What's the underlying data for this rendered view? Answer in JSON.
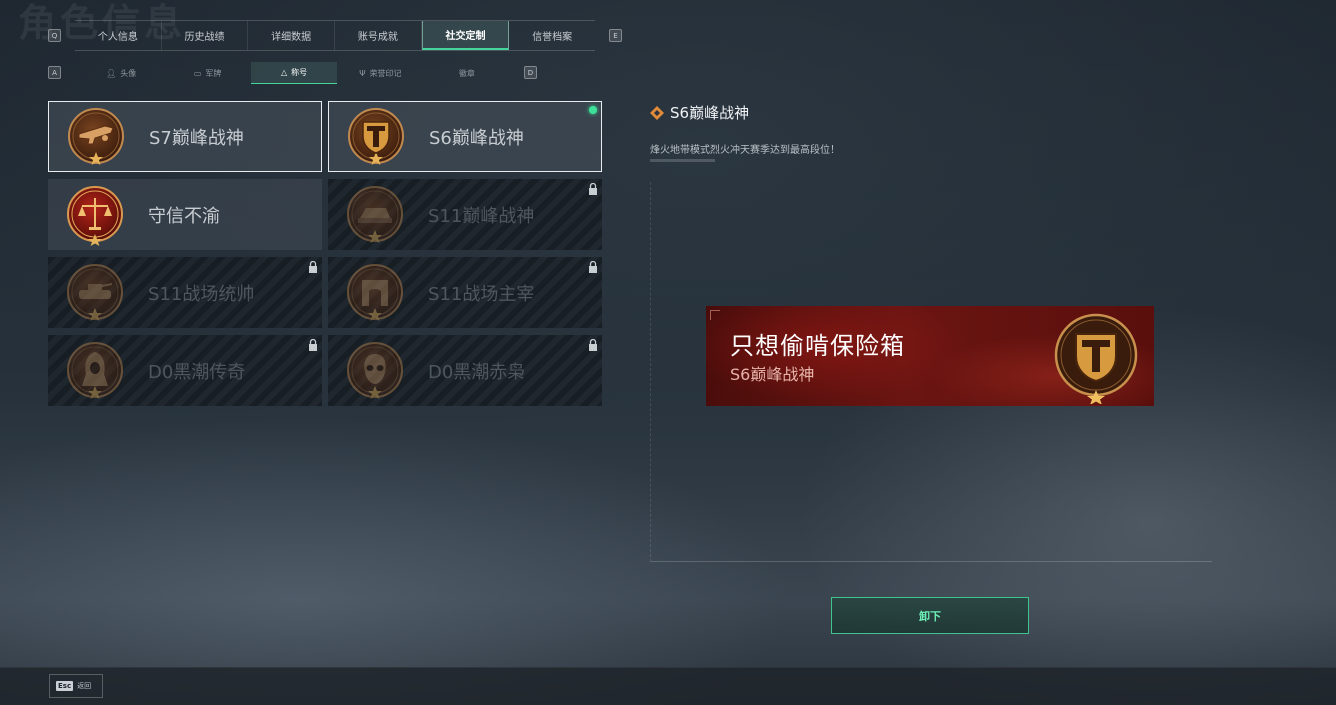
{
  "page": {
    "background_title": "角色信息"
  },
  "top_tabs": {
    "left_key": "Q",
    "right_key": "E",
    "items": [
      {
        "label": "个人信息",
        "active": false
      },
      {
        "label": "历史战绩",
        "active": false
      },
      {
        "label": "详细数据",
        "active": false
      },
      {
        "label": "账号成就",
        "active": false
      },
      {
        "label": "社交定制",
        "active": true
      },
      {
        "label": "信誉档案",
        "active": false
      }
    ]
  },
  "sub_tabs": {
    "left_key": "A",
    "right_key": "D",
    "items": [
      {
        "label": "头像",
        "icon": "person-icon",
        "active": false
      },
      {
        "label": "军牌",
        "icon": "dogtag-icon",
        "active": false
      },
      {
        "label": "称号",
        "icon": "title-icon",
        "active": true
      },
      {
        "label": "荣誉印记",
        "icon": "honor-icon",
        "active": false
      },
      {
        "label": "徽章",
        "icon": "badge-icon",
        "active": false
      }
    ]
  },
  "titles": [
    {
      "label": "S7巅峰战神",
      "icon": "weapon-medal-icon",
      "state": "selected",
      "locked": false
    },
    {
      "label": "S6巅峰战神",
      "icon": "shield-t-medal-icon",
      "state": "equipped",
      "locked": false
    },
    {
      "label": "守信不渝",
      "icon": "scales-medal-icon",
      "state": "normal",
      "locked": false
    },
    {
      "label": "S11巅峰战神",
      "icon": "vehicle-medal-icon",
      "state": "normal",
      "locked": true
    },
    {
      "label": "S11战场统帅",
      "icon": "tank-medal-icon",
      "state": "normal",
      "locked": true
    },
    {
      "label": "S11战场主宰",
      "icon": "gate-medal-icon",
      "state": "normal",
      "locked": true
    },
    {
      "label": "D0黑潮传奇",
      "icon": "hooded-figure-medal-icon",
      "state": "normal",
      "locked": true
    },
    {
      "label": "D0黑潮赤枭",
      "icon": "skull-mask-medal-icon",
      "state": "normal",
      "locked": true
    }
  ],
  "detail": {
    "title": "S6巅峰战神",
    "description": "烽火地带模式烈火冲天赛季达到最高段位！",
    "icon": "diamond-icon"
  },
  "preview_banner": {
    "player_name": "只想偷啃保险箱",
    "title": "S6巅峰战神",
    "icon": "shield-t-medal-icon"
  },
  "actions": {
    "unequip_label": "卸下"
  },
  "bottom": {
    "esc_key": "Esc",
    "esc_label": "返回"
  },
  "colors": {
    "accent_green": "#44d59b",
    "medal_bronze": "#b47a3f",
    "banner_red": "#6b1512"
  }
}
